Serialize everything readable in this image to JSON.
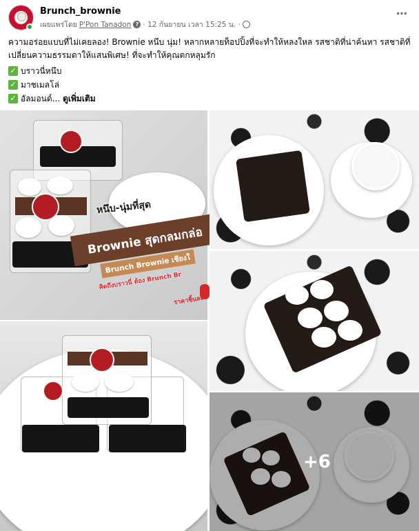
{
  "post": {
    "page_name": "Brunch_brownie",
    "meta_prefix": "เผยแพร่โดย",
    "author": "P'Pon Tanadon",
    "date": "· 12 กันยายน เวลา 15:25 น. ·",
    "more_icon": "⋯",
    "body": "ความอร่อยแบบที่ไม่เคยลอง! Brownie หนึบ นุ่ม! หลากหลายท็อปปิ้งที่จะทำให้หลงใหล รสชาติที่น่าค้นหา รสชาติที่เปลี่ยนความธรรมดาให้แสนพิเศษ! ที่จะทำให้คุณตกหลุมรัก",
    "list": [
      {
        "icon": "check-icon",
        "text": "บราวนี่หนึบ"
      },
      {
        "icon": "check-icon",
        "text": "มาชเมลโล่"
      },
      {
        "icon": "check-icon",
        "text": "อัลมอนด์..."
      }
    ],
    "see_more": "ดูเพิ่มเติม"
  },
  "photos": {
    "banner_top": "หนึบ-นุ่มที่สุด",
    "banner_main": "Brownie สุดกลมกล่อ",
    "banner_sub": "Brunch Brownie เชียงใ",
    "banner_line2": "คิดถึงบราวนี่ ต้อง Brunch Br",
    "banner_line3": "ราคาชิ้นละ",
    "extra_count": "+6"
  },
  "colors": {
    "brand_red": "#c8102e",
    "banner_brown": "#6b3f2a",
    "check_green": "#5bb43c"
  }
}
